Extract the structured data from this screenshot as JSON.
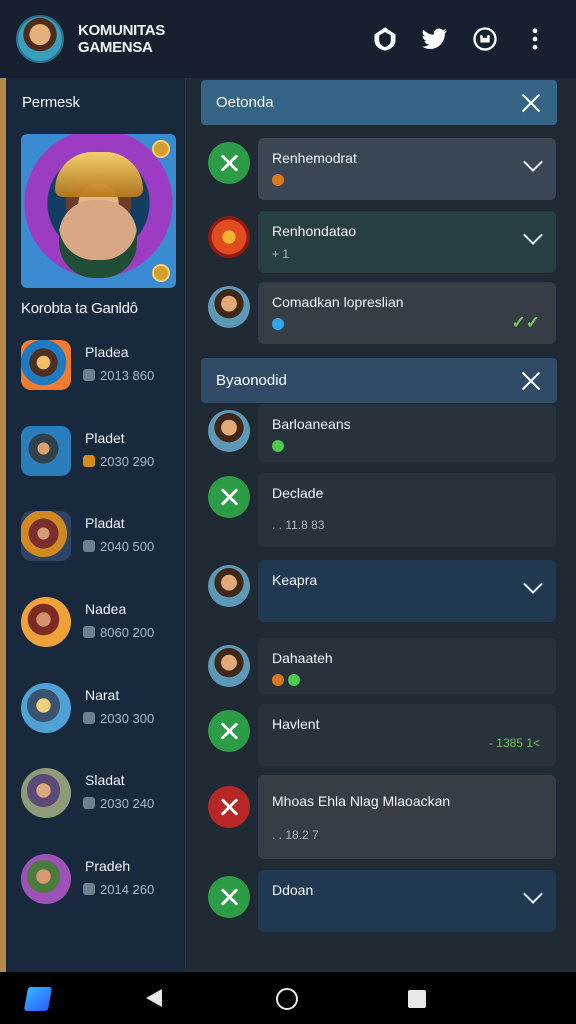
{
  "app": {
    "title_line_1": "KOMUNITAS",
    "title_line_2": "GAMENSA"
  },
  "topbar": {
    "icons": [
      "shield-home-icon",
      "bird-icon",
      "gamepad-icon",
      "more-vertical-icon"
    ]
  },
  "sidebar": {
    "heading": "Permesk",
    "feature_caption": "Korobta ta Ganldô",
    "players": [
      {
        "name": "Pladea",
        "meta": "2013 860",
        "icon": "hero-icon"
      },
      {
        "name": "Pladet",
        "meta": "2030 290",
        "icon": "warrior-icon"
      },
      {
        "name": "Pladat",
        "meta": "2040 500",
        "icon": "archer-icon"
      },
      {
        "name": "Nadea",
        "meta": "8060 200",
        "icon": "fighter-icon"
      },
      {
        "name": "Narat",
        "meta": "2030 300",
        "icon": "ranger-icon"
      },
      {
        "name": "Sladat",
        "meta": "2030 240",
        "icon": "knight-icon"
      },
      {
        "name": "Pradeh",
        "meta": "2014 260",
        "icon": "mage-icon"
      }
    ]
  },
  "panel_1": {
    "title": "Oetonda",
    "items": [
      {
        "title": "Renhemodrat",
        "sub": "",
        "state": "collapsed",
        "icon": "crossed-swords-icon"
      },
      {
        "title": "Renhondatao",
        "sub": "+ 1",
        "state": "collapsed",
        "icon": "fire-orb-icon"
      },
      {
        "title": "Comadkan lopreslian",
        "sub": "",
        "state": "read",
        "icon": "player-avatar-icon"
      }
    ]
  },
  "panel_2": {
    "title": "Byaonodid",
    "items": [
      {
        "title": "Barloaneans",
        "sub": "",
        "icon": "player-avatar-icon"
      },
      {
        "title": "Declade",
        "sub": ". . 11.8 83",
        "icon": "crossed-swords-icon"
      },
      {
        "title": "Keapra",
        "sub": "",
        "state": "collapsed",
        "icon": "sniper-avatar-icon"
      },
      {
        "title": "Dahaateh",
        "sub": "",
        "icon": "player-avatar-icon"
      },
      {
        "title": "Havlent",
        "sub": "- 1385 1<",
        "icon": "crossed-swords-icon"
      },
      {
        "title": "Mhoas Ehla Nlag Mlaoackan",
        "sub": ". . 18.2 7",
        "icon": "red-swords-icon"
      },
      {
        "title": "Ddoan",
        "sub": "",
        "state": "collapsed",
        "icon": "crossed-swords-icon"
      }
    ]
  },
  "navigation": {
    "items": [
      "app-icon",
      "back-icon",
      "home-icon",
      "recent-apps-icon"
    ]
  }
}
